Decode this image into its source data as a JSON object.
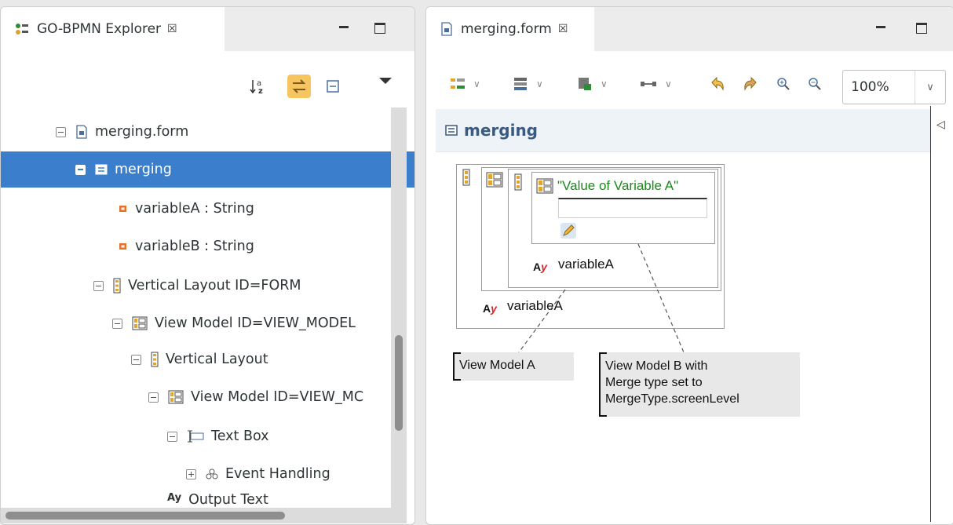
{
  "explorer": {
    "tab_title": "GO-BPMN Explorer",
    "tab_close": "☒",
    "toolbar": {
      "sort_icon": "sort-alphabetical-icon",
      "link_icon": "link-with-editor-icon",
      "collapse_icon": "collapse-all-icon",
      "menu_icon": "view-menu-icon"
    },
    "tree": [
      {
        "label": "merging.form",
        "expander": "minus",
        "icon": "form-file-icon"
      },
      {
        "label": "merging",
        "expander": "minus",
        "icon": "form-icon",
        "selected": true
      },
      {
        "label": "variableA : String",
        "expander": "none",
        "icon": "variable-icon"
      },
      {
        "label": "variableB : String",
        "expander": "none",
        "icon": "variable-icon"
      },
      {
        "label": "Vertical Layout ID=FORM",
        "expander": "minus",
        "icon": "vertical-layout-icon"
      },
      {
        "label": "View Model ID=VIEW_MODEL",
        "expander": "minus",
        "icon": "view-model-icon"
      },
      {
        "label": "Vertical Layout",
        "expander": "minus",
        "icon": "vertical-layout-icon"
      },
      {
        "label": "View Model ID=VIEW_MC",
        "expander": "minus",
        "icon": "view-model-icon"
      },
      {
        "label": "Text Box",
        "expander": "minus",
        "icon": "text-box-icon"
      },
      {
        "label": "Event Handling",
        "expander": "plus",
        "icon": "event-handling-icon"
      },
      {
        "label": "Output Text",
        "expander": "none",
        "icon": "output-text-icon"
      }
    ]
  },
  "editor": {
    "tab_title": "merging.form",
    "tab_close": "☒",
    "zoom": "100%",
    "zoom_dropdown": "∨",
    "toolbar_chevron": "∨",
    "form_title": "merging",
    "collapse_arrow": "◁",
    "canvas": {
      "textbox_label": "\"Value of Variable A\"",
      "inner_variable": "variableA",
      "outer_variable": "variableA",
      "ay_a": "A",
      "ay_y": "y"
    },
    "callouts": {
      "view_model_a": "View Model A",
      "view_model_b": [
        "View Model B with",
        "Merge type set to",
        "MergeType.screenLevel"
      ]
    }
  },
  "colors": {
    "selection": "#3b7fcc",
    "label_green": "#1a8a1a",
    "active_toggle": "#f6c560"
  }
}
